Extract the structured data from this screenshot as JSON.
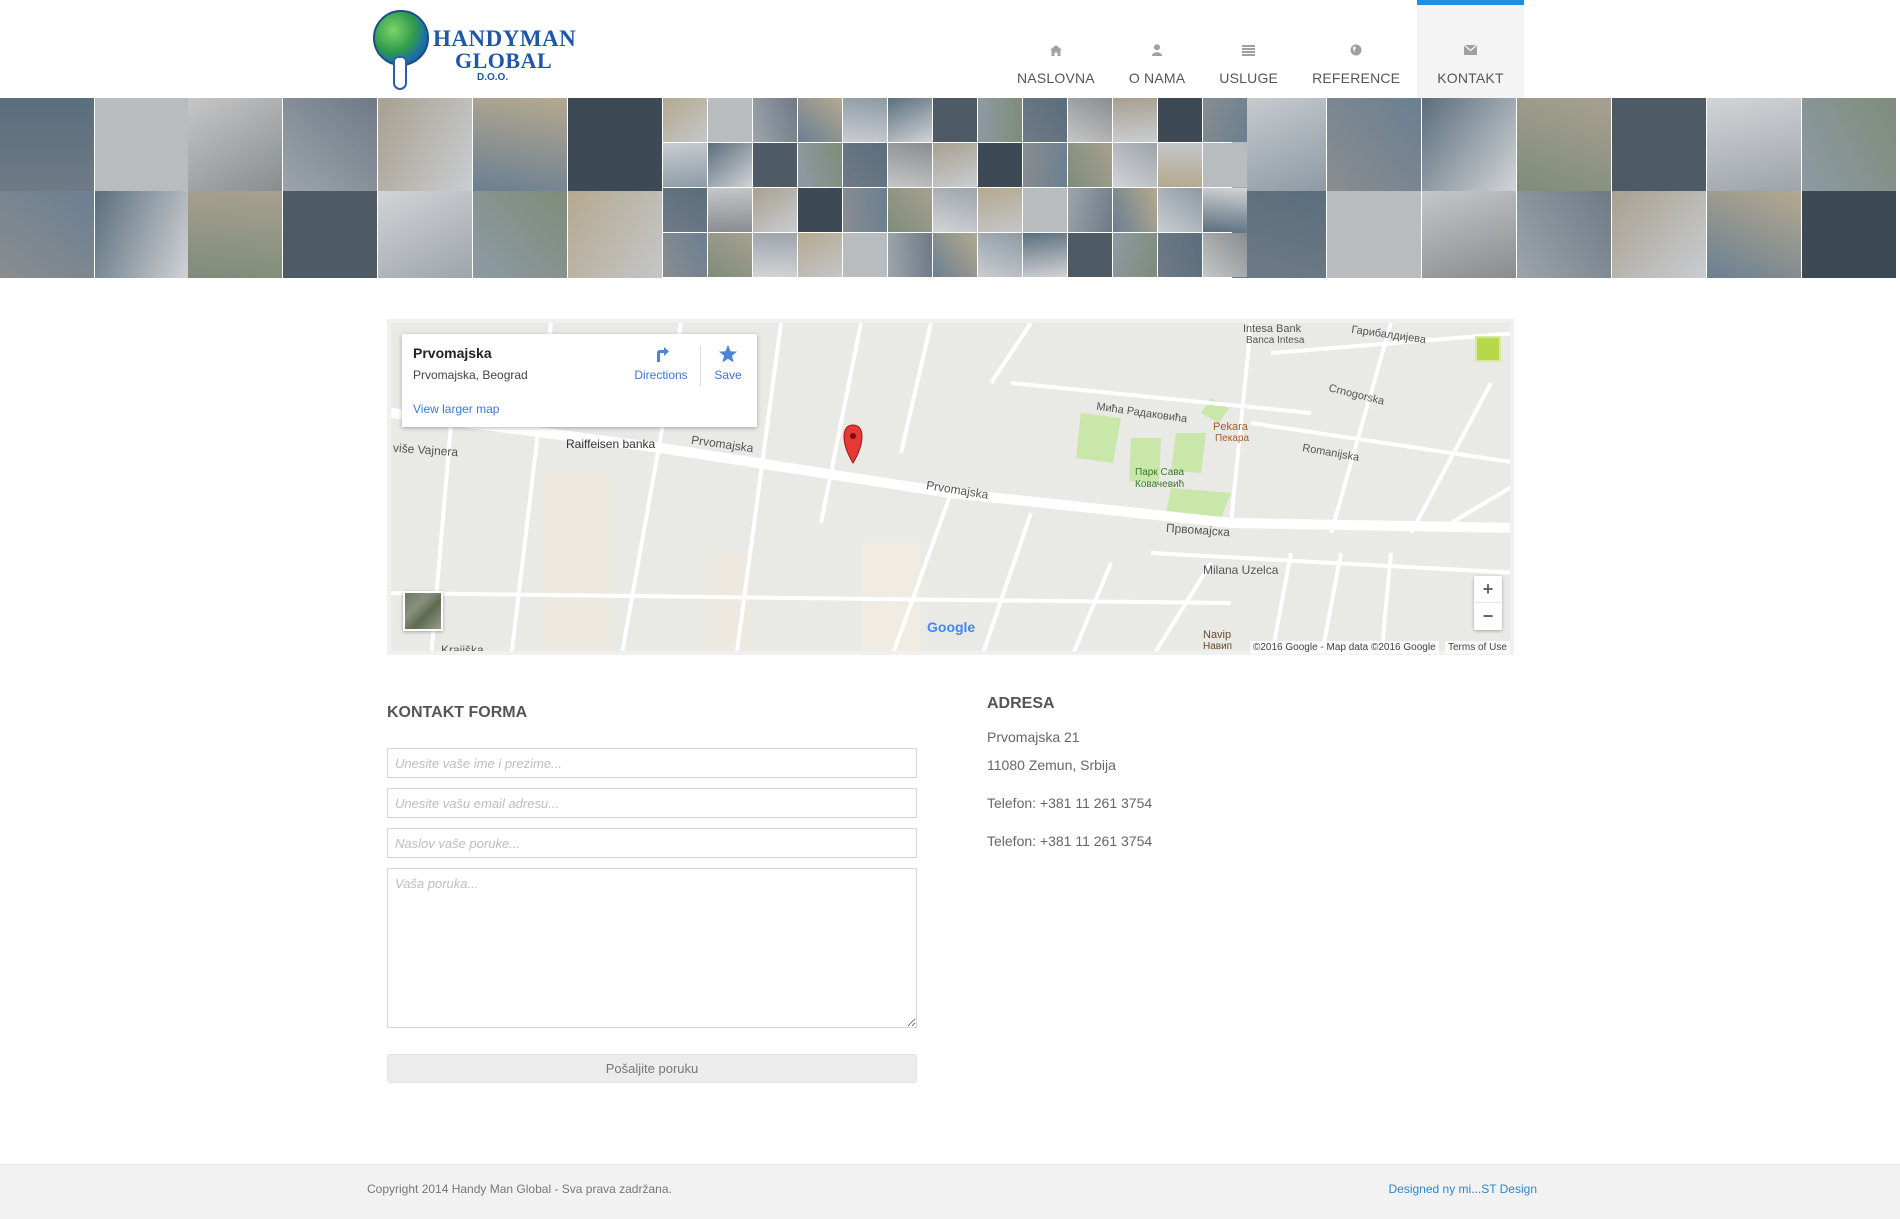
{
  "logo": {
    "line1": "HANDYMAN",
    "line2": "GLOBAL",
    "line3": "D.O.O."
  },
  "nav": {
    "items": [
      {
        "label": "NASLOVNA",
        "icon": "home-icon"
      },
      {
        "label": "O NAMA",
        "icon": "user-icon"
      },
      {
        "label": "USLUGE",
        "icon": "list-icon"
      },
      {
        "label": "REFERENCE",
        "icon": "globe-icon"
      },
      {
        "label": "KONTAKT",
        "icon": "envelope-icon",
        "active": true
      }
    ],
    "accent": "#1e8fe0"
  },
  "map": {
    "place_name": "Prvomajska",
    "place_address": "Prvomajska, Beograd",
    "directions_label": "Directions",
    "save_label": "Save",
    "view_larger_label": "View larger map",
    "copyright": "©2016 Google - Map data ©2016 Google",
    "terms": "Terms of Use",
    "labels": {
      "intesa": "Intesa Bank",
      "intesa_sub": "Banca Intesa",
      "garibaldijeva": "Гарибалдијева",
      "crnogorska": "Crnogorska",
      "mice": "Мића Радаковића",
      "pekara": "Pekara",
      "pekara_sub": "Пекара",
      "romanijska": "Romanijska",
      "raiffeisen": "Raiffeisen banka",
      "prvomajska1": "Prvomajska",
      "prvomajska2": "Prvomajska",
      "prvomajska_cyr": "Првомајска",
      "park": "Парк Сава",
      "park_sub": "Ковачевић",
      "milana": "Milana Uzelca",
      "navip": "Navip",
      "navip_sub": "Навип",
      "vajnera": "više Vajnera",
      "krajiska": "Krajiška",
      "google": "Google"
    }
  },
  "form": {
    "title": "KONTAKT FORMA",
    "name_placeholder": "Unesite vaše ime i prezime...",
    "email_placeholder": "Unesite vašu email adresu...",
    "subject_placeholder": "Naslov vaše poruke...",
    "message_placeholder": "Vaša poruka...",
    "submit_label": "Pošaljite poruku"
  },
  "address": {
    "title": "ADRESA",
    "street": "Prvomajska 21",
    "city": "11080 Zemun, Srbija",
    "phone1": "Telefon: +381 11 261 3754",
    "phone2": "Telefon: +381 11 261 3754"
  },
  "footer": {
    "copyright": "Copyright 2014 Handy Man Global - Sva prava zadržana.",
    "designer": "Designed ny mi...ST Design"
  }
}
